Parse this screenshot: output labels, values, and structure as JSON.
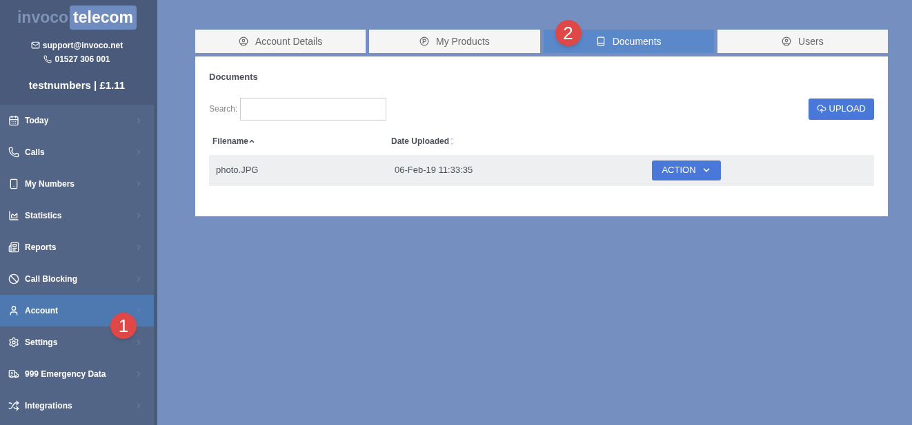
{
  "logo": {
    "part_1": "invoco",
    "part_2": "telecom"
  },
  "contact": {
    "email": "support@invoco.net",
    "phone": "01527 306 001"
  },
  "account_balance": "testnumbers | £1.11",
  "sidebar": {
    "items": [
      {
        "label": "Today",
        "kind": "calendar",
        "selected": false
      },
      {
        "label": "Calls",
        "kind": "phone",
        "selected": false
      },
      {
        "label": "My Numbers",
        "kind": "numbers",
        "selected": false
      },
      {
        "label": "Statistics",
        "kind": "chart",
        "selected": false
      },
      {
        "label": "Reports",
        "kind": "reports",
        "selected": false
      },
      {
        "label": "Call Blocking",
        "kind": "block",
        "selected": false
      },
      {
        "label": "Account",
        "kind": "user",
        "selected": true,
        "annotation": "1"
      },
      {
        "label": "Settings",
        "kind": "settings",
        "selected": false
      },
      {
        "label": "999 Emergency Data",
        "kind": "ambulance",
        "selected": false
      },
      {
        "label": "Integrations",
        "kind": "shuffle",
        "selected": false
      }
    ]
  },
  "tabs": [
    {
      "label": "Account Details",
      "kind": "user",
      "selected": false
    },
    {
      "label": "My Products",
      "kind": "products",
      "selected": false
    },
    {
      "label": "Documents",
      "kind": "book",
      "selected": true,
      "annotation": "2"
    },
    {
      "label": "Users",
      "kind": "user",
      "selected": false
    }
  ],
  "panel": {
    "title": "Documents",
    "search": {
      "label": "Search:"
    },
    "upload_button": "UPLOAD",
    "table": {
      "columns": [
        {
          "label": "Filename",
          "sorted": true
        },
        {
          "label": "Date Uploaded",
          "sorted": false
        }
      ],
      "rows": [
        {
          "filename": "photo.JPG",
          "date_uploaded": "06-Feb-19 11:33:35",
          "action": "ACTION"
        }
      ]
    }
  }
}
